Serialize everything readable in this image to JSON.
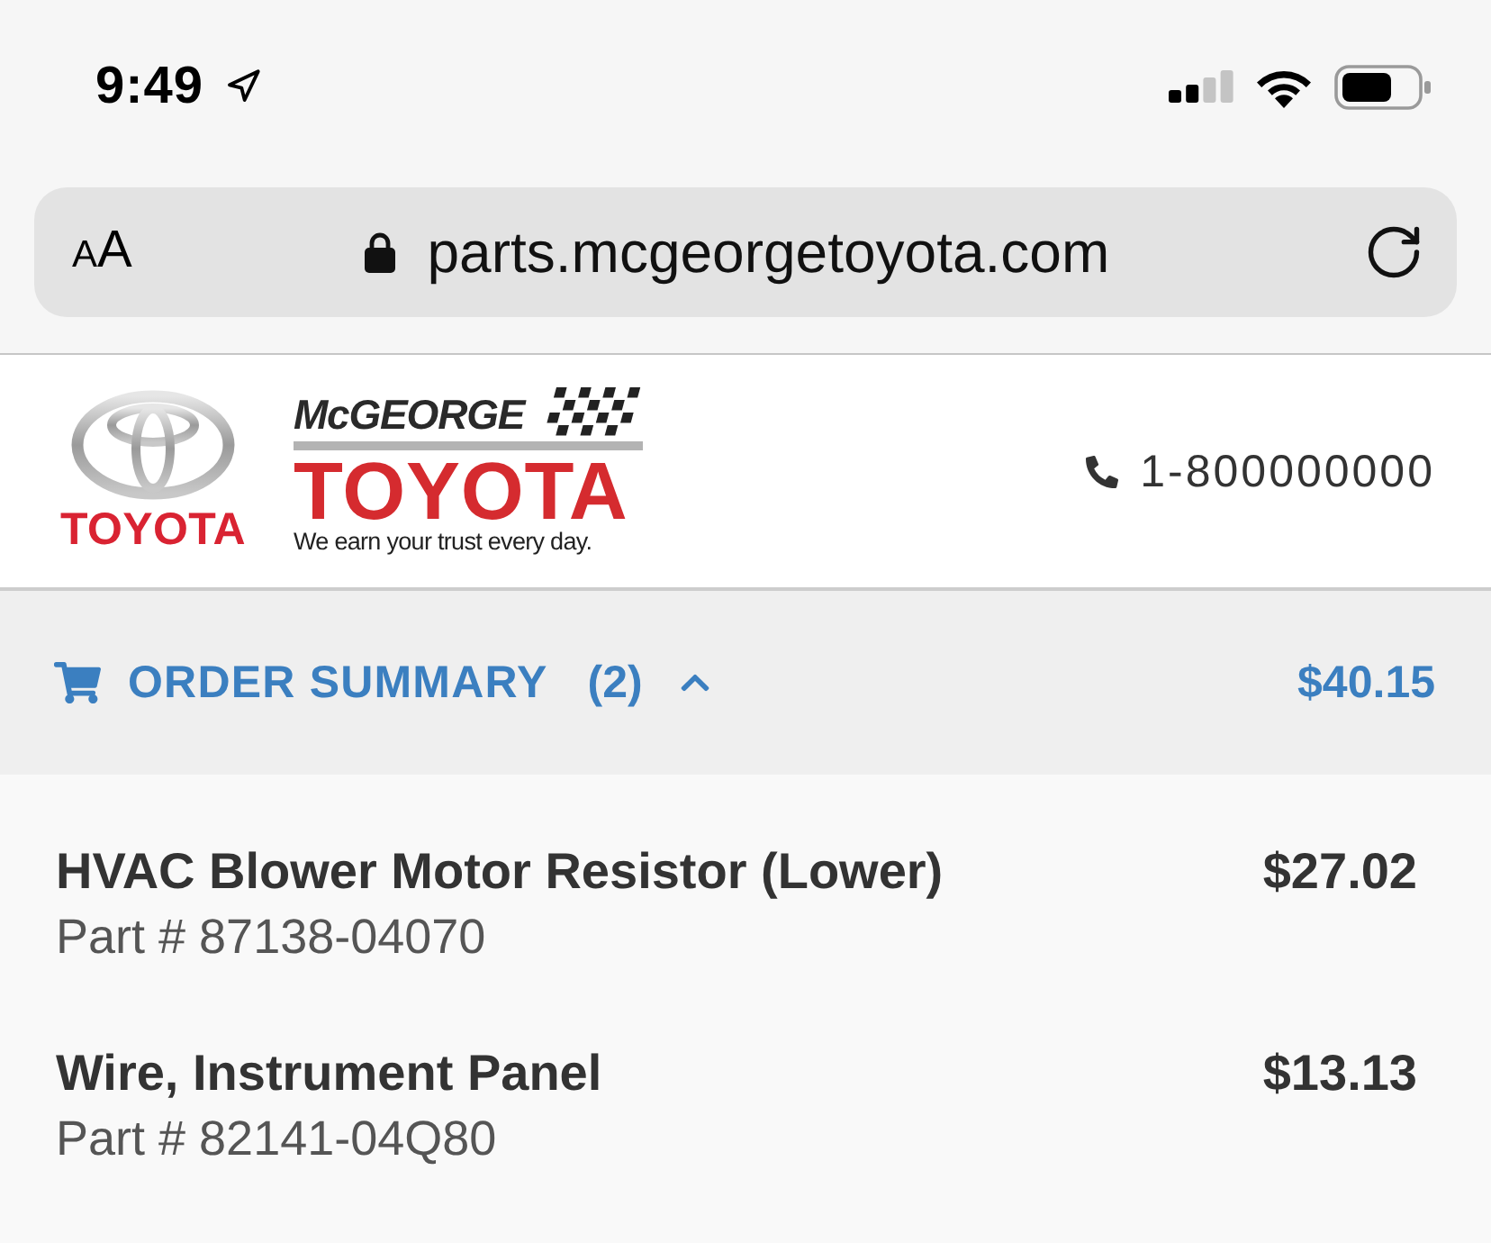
{
  "status_bar": {
    "time": "9:49",
    "location_services": true
  },
  "address_bar": {
    "text_size_button": "AA",
    "url": "parts.mcgeorgetoyota.com",
    "secure": true
  },
  "header": {
    "brand_logo": {
      "wordmark": "TOYOTA"
    },
    "dealer_logo": {
      "name": "McGEORGE",
      "wordmark": "TOYOTA",
      "tagline": "We earn your trust every day."
    },
    "phone": "1-800000000"
  },
  "order_summary": {
    "title": "ORDER SUMMARY",
    "count": "(2)",
    "expanded": true,
    "total": "$40.15"
  },
  "items": [
    {
      "name": "HVAC Blower Motor Resistor (Lower)",
      "price": "$27.02",
      "part_number": "Part # 87138-04070"
    },
    {
      "name": "Wire, Instrument Panel",
      "price": "$13.13",
      "part_number": "Part # 82141-04Q80"
    }
  ]
}
